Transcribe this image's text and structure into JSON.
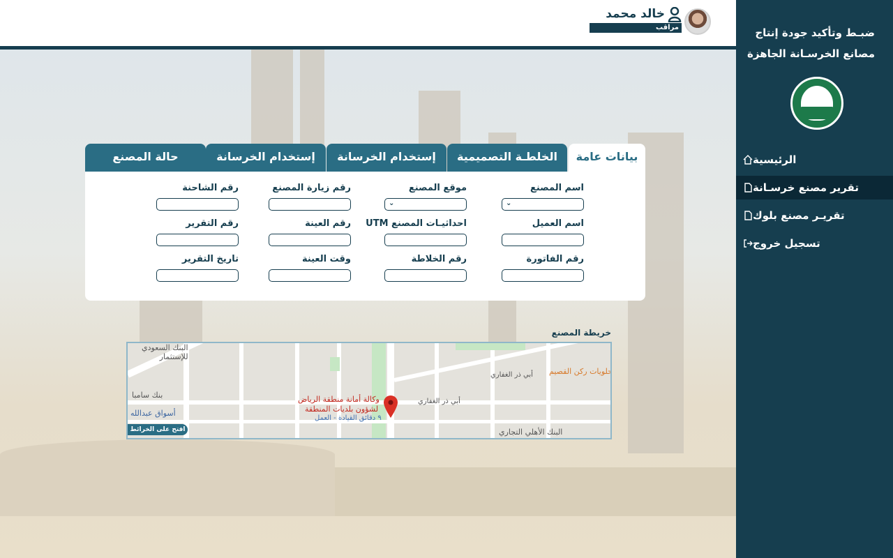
{
  "app": {
    "title_line1": "ضبـط وتأكيد جودة إنتاج",
    "title_line2": "مصانع الخرسـانة الجاهزة"
  },
  "user": {
    "name": "خالد محمد",
    "role": "مراقب"
  },
  "sidebar": {
    "items": [
      {
        "label": "الرئيسية",
        "icon": "home-icon",
        "active": false
      },
      {
        "label": "تقرير مصنع خرسـانة",
        "icon": "document-icon",
        "active": true
      },
      {
        "label": "تقريـر مصنع بلوك",
        "icon": "document-icon",
        "active": false
      },
      {
        "label": "تسجيل خروج",
        "icon": "logout-icon",
        "active": false
      }
    ]
  },
  "tabs": [
    {
      "label": "بيانات عامة",
      "active": true
    },
    {
      "label": "الخلطـة التصميمية",
      "active": false
    },
    {
      "label": "إستخدام الخرسانة",
      "active": false
    },
    {
      "label": "إستخدام الخرسانة",
      "active": false
    },
    {
      "label": "حالة المصنع",
      "active": false
    }
  ],
  "form": {
    "factory_name": "اسم المصنع",
    "factory_location": "موقع المصنع",
    "factory_visit_no": "رقم زيارة المصنع",
    "truck_no": "رقم الشاحنة",
    "client_name": "اسم العميل",
    "utm": "احداثيـات المصنع UTM",
    "sample_no": "رقم العينة",
    "report_no": "رقم التقرير",
    "invoice_no": "رقم الفاتورة",
    "mix_no": "رقم الخلاطة",
    "sample_time": "وقت العينة",
    "report_date": "تاريخ التقرير"
  },
  "map": {
    "title": "خريطة المصنع",
    "open_button": "افتح على الخرائط",
    "place_name_1": "وكالة أمانة منطقة الرياض",
    "place_name_2": "لشؤون بلديات المنطقة",
    "drive_time": "٩ دقائق القيادة - العمل",
    "poi_bank_saudi_1": "البنك السعودي",
    "poi_bank_saudi_2": "للإستثمار",
    "poi_samba": "بنك سامبا",
    "poi_aswaq": "أسواق عبدالله",
    "poi_ahli": "البنك الأهلي التجاري",
    "poi_sweets": "حلويات ركن القصيم",
    "street_1": "أبي ذر الغفاري",
    "street_2": "أبي ذر الغفاري"
  },
  "colors": {
    "primary": "#163e4f",
    "tab": "#2a6d84",
    "map_pin": "#d93025"
  }
}
